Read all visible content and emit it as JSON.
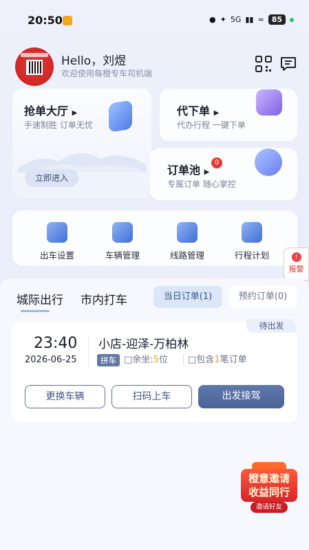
{
  "status_bar": {
    "time": "20:50",
    "network": "5G",
    "battery": "85"
  },
  "header": {
    "greeting": "Hello，刘煜",
    "subtitle": "欢迎使用每橙专车司机端",
    "scan_icon": "qr-scan-icon",
    "message_icon": "message-icon"
  },
  "cards": {
    "grab": {
      "title": "抢单大厅",
      "subtitle": "手速制胜 订单无忧",
      "enter": "立即进入"
    },
    "proxy": {
      "title": "代下单",
      "subtitle": "代办行程 一键下单"
    },
    "pool": {
      "title": "订单池",
      "subtitle": "专属订单 随心掌控",
      "badge": "0"
    }
  },
  "tools": [
    {
      "label": "出车设置",
      "icon": "vehicle-settings-icon"
    },
    {
      "label": "车辆管理",
      "icon": "vehicle-management-icon"
    },
    {
      "label": "线路管理",
      "icon": "route-management-icon"
    },
    {
      "label": "行程计划",
      "icon": "trip-plan-icon"
    }
  ],
  "report": {
    "label": "报警"
  },
  "tabs": {
    "intercity": "城际出行",
    "city": "市内打车",
    "today": "当日订单(1)",
    "booked": "预约订单(0)"
  },
  "order": {
    "status": "待出发",
    "time": "23:40",
    "date": "2026-06-25",
    "route": "小店-迎泽-万柏林",
    "type": "拼车",
    "seats_label": "余坐:",
    "seats_value": "5",
    "seats_unit": "位",
    "contains_label": "包含",
    "contains_value": "1",
    "contains_unit": "笔订单",
    "btn_change": "更换车辆",
    "btn_scan": "扫码上车",
    "btn_depart": "出发接驾"
  },
  "promo": {
    "line1": "橙意邀请",
    "line2": "收益同行",
    "cta": "邀请好友"
  },
  "colors": {
    "accent": "#4a6297",
    "highlight": "#f0a020",
    "alert": "#e03131"
  }
}
